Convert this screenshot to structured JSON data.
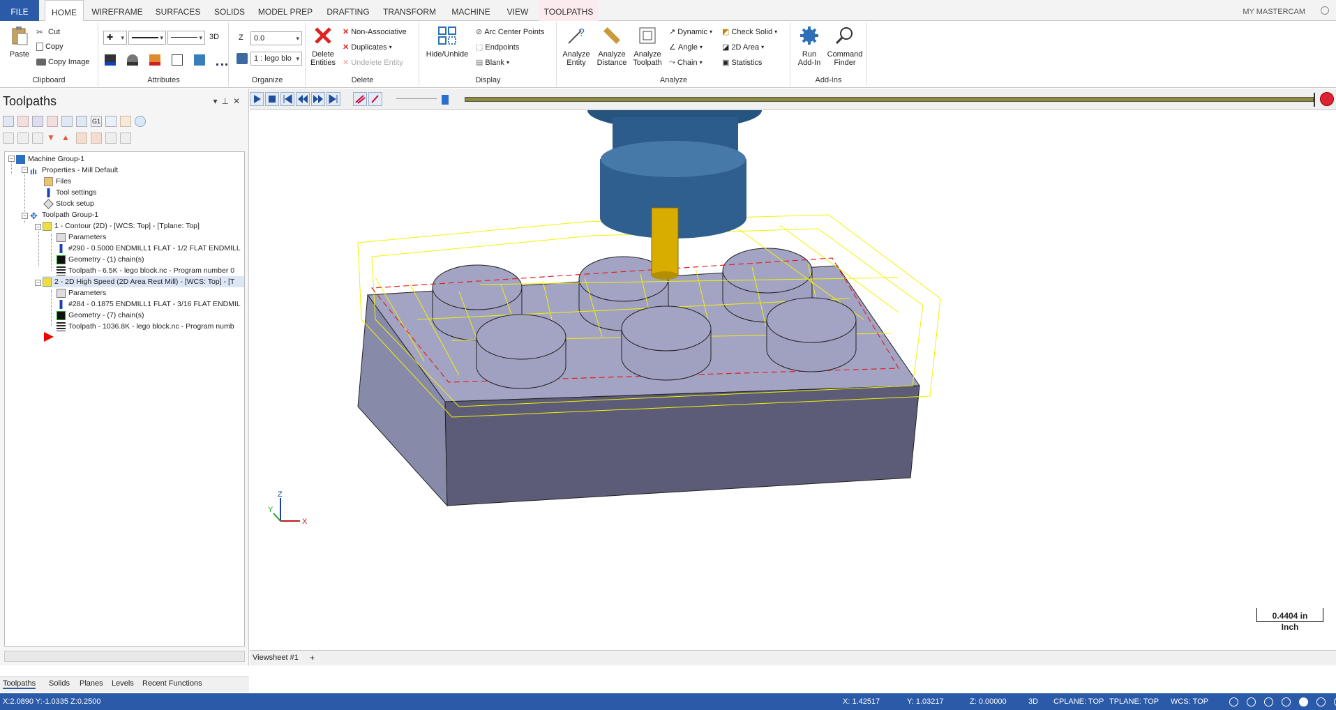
{
  "tabs": [
    "FILE",
    "HOME",
    "WIREFRAME",
    "SURFACES",
    "SOLIDS",
    "MODEL PREP",
    "DRAFTING",
    "TRANSFORM",
    "MACHINE",
    "VIEW",
    "TOOLPATHS"
  ],
  "account": "MY MASTERCAM",
  "ribbon": {
    "clipboard": {
      "label": "Clipboard",
      "paste": "Paste",
      "cut": "Cut",
      "copy": "Copy",
      "copy_image": "Copy Image"
    },
    "attributes": {
      "label": "Attributes",
      "mode": "3D"
    },
    "organize": {
      "label": "Organize",
      "z_label": "Z",
      "z_value": "0.0",
      "level": "1 : lego blo"
    },
    "delete": {
      "label": "Delete",
      "delete_entities": "Delete Entities",
      "non_associative": "Non-Associative",
      "duplicates": "Duplicates",
      "undelete": "Undelete Entity"
    },
    "display": {
      "label": "Display",
      "hide_unhide": "Hide/Unhide",
      "arc_center": "Arc Center Points",
      "endpoints": "Endpoints",
      "blank": "Blank"
    },
    "analyze": {
      "label": "Analyze",
      "entity": "Analyze Entity",
      "distance": "Analyze Distance",
      "toolpath": "Analyze Toolpath",
      "dynamic": "Dynamic",
      "angle": "Angle",
      "chain": "Chain",
      "check_solid": "Check Solid",
      "area": "2D Area",
      "statistics": "Statistics"
    },
    "addins": {
      "label": "Add-Ins",
      "run": "Run Add-In",
      "finder": "Command Finder"
    }
  },
  "panel": {
    "title": "Toolpaths",
    "tree": [
      {
        "label": "Machine Group-1"
      },
      {
        "label": "Properties - Mill Default"
      },
      {
        "label": "Files"
      },
      {
        "label": "Tool settings"
      },
      {
        "label": "Stock setup"
      },
      {
        "label": "Toolpath Group-1"
      },
      {
        "label": "1 - Contour (2D) - [WCS: Top] - [Tplane: Top]"
      },
      {
        "label": "Parameters"
      },
      {
        "label": "#290 - 0.5000 ENDMILL1 FLAT - 1/2 FLAT ENDMILL"
      },
      {
        "label": "Geometry - (1) chain(s)"
      },
      {
        "label": "Toolpath - 6.5K - lego block.nc - Program number 0"
      },
      {
        "label": "2 - 2D High Speed (2D Area Rest Mill) - [WCS: Top] - [T"
      },
      {
        "label": "Parameters"
      },
      {
        "label": "#284 - 0.1875 ENDMILL1 FLAT - 3/16 FLAT ENDMIL"
      },
      {
        "label": "Geometry - (7) chain(s)"
      },
      {
        "label": "Toolpath - 1036.8K - lego block.nc - Program numb"
      }
    ],
    "bottom_tabs": [
      "Toolpaths",
      "Solids",
      "Planes",
      "Levels",
      "Recent Functions"
    ]
  },
  "viewport": {
    "scale_value": "0.4404 in",
    "scale_unit": "Inch",
    "viewsheet": "Viewsheet #1",
    "axis_x": "X",
    "axis_y": "Y",
    "axis_z": "Z"
  },
  "status": {
    "cursor": "X:2.0890   Y:-1.0335   Z:0.2500",
    "x": "X:   1.42517",
    "y": "Y:   1.03217",
    "z": "Z:   0.00000",
    "mode": "3D",
    "cplane": "CPLANE: TOP",
    "tplane": "TPLANE: TOP",
    "wcs": "WCS: TOP"
  },
  "colors": {
    "accent": "#2b5ba8",
    "toolpath": "#f2f200",
    "solid_top": "#a3a4c4",
    "solid_front": "#5c5c78",
    "spindle": "#2e5f8f"
  }
}
